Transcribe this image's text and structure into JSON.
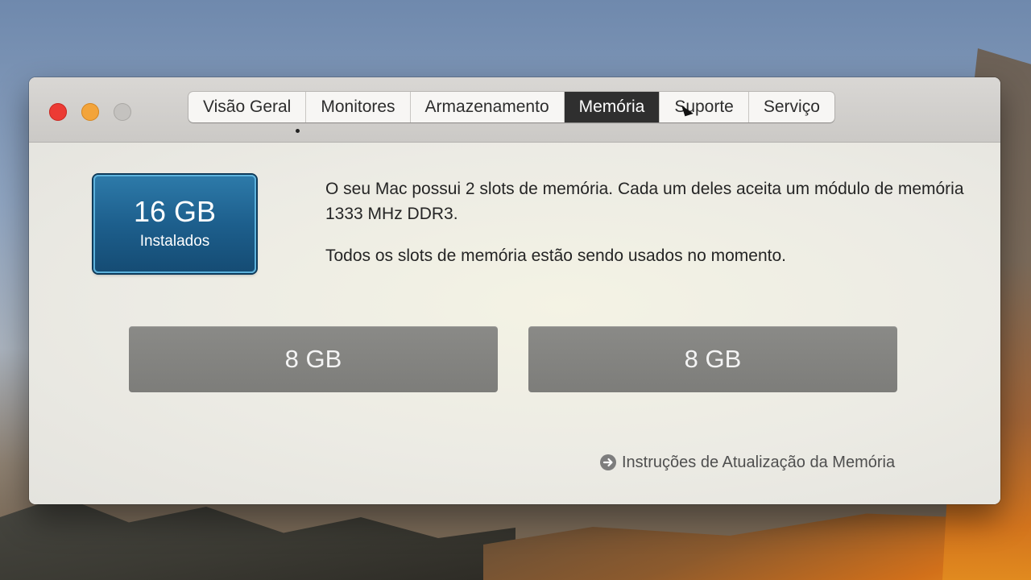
{
  "window": {
    "tabs": [
      {
        "label": "Visão Geral",
        "active": false
      },
      {
        "label": "Monitores",
        "active": false
      },
      {
        "label": "Armazenamento",
        "active": false
      },
      {
        "label": "Memória",
        "active": true
      },
      {
        "label": "Suporte",
        "active": false
      },
      {
        "label": "Serviço",
        "active": false
      }
    ]
  },
  "memory": {
    "total": "16 GB",
    "total_label": "Instalados",
    "description": "O seu Mac possui 2 slots de memória. Cada um deles aceita um módulo de memória 1333 MHz DDR3.",
    "status": "Todos os slots de memória estão sendo usados no momento.",
    "slots": [
      "8 GB",
      "8 GB"
    ],
    "upgrade_link": "Instruções de Atualização da Memória"
  },
  "colors": {
    "close": "#ec3b34",
    "minimize": "#f3a43a",
    "maximize": "#c4c2bf",
    "badge": "#1d5f8d",
    "slot": "#828280",
    "active_tab": "#2f2f2f"
  },
  "icons": {
    "upgrade_link": "arrow-right-circle-icon"
  }
}
